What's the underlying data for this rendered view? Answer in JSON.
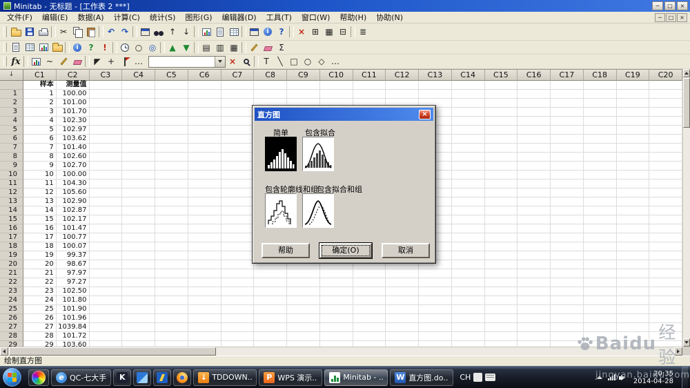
{
  "titlebar": {
    "title": "Minitab - 无标题 - [工作表 2 ***]",
    "buttons": [
      "─",
      "□",
      "×"
    ]
  },
  "menubar": {
    "items": [
      "文件(F)",
      "编辑(E)",
      "数据(A)",
      "计算(C)",
      "统计(S)",
      "图形(G)",
      "编辑器(D)",
      "工具(T)",
      "窗口(W)",
      "帮助(H)",
      "协助(N)"
    ],
    "mdi_buttons": [
      "─",
      "□",
      "×"
    ]
  },
  "toolbars": {
    "row1": [
      {
        "name": "open-project-icon",
        "t": "folder"
      },
      {
        "name": "save-project-icon",
        "t": "floppy"
      },
      {
        "name": "print-icon",
        "t": "printer"
      },
      {
        "sep": true
      },
      {
        "name": "cut-icon",
        "g": "✂"
      },
      {
        "name": "copy-icon",
        "t": "copy"
      },
      {
        "name": "paste-icon",
        "t": "paste"
      },
      {
        "sep": true
      },
      {
        "name": "undo-icon",
        "g": "↶",
        "c": "blue"
      },
      {
        "name": "redo-icon",
        "g": "↷",
        "c": "blue"
      },
      {
        "sep": true
      },
      {
        "name": "last-dialog-icon",
        "t": "window"
      },
      {
        "name": "find-icon",
        "t": "binoc"
      },
      {
        "name": "previous-command-icon",
        "g": "↑"
      },
      {
        "name": "next-command-icon",
        "g": "↓"
      },
      {
        "sep": true
      },
      {
        "name": "edit-last-graph-icon",
        "t": "chart"
      },
      {
        "name": "session-window-icon",
        "t": "doc"
      },
      {
        "name": "data-window-icon",
        "t": "grid"
      },
      {
        "sep": true
      },
      {
        "name": "project-manager-icon",
        "t": "window"
      },
      {
        "name": "statguide-icon",
        "t": "info"
      },
      {
        "name": "help-icon",
        "g": "?",
        "c": "blue"
      },
      {
        "sep": true
      },
      {
        "name": "close-all-graphs-icon",
        "g": "×",
        "c": "red"
      },
      {
        "name": "tile-windows-icon",
        "g": "⊞"
      },
      {
        "name": "cascade-windows-icon",
        "g": "▦"
      },
      {
        "name": "minimize-all-icon",
        "g": "⊟"
      },
      {
        "sep": true
      },
      {
        "name": "customize-toolbar-icon",
        "g": "≣"
      }
    ],
    "row2": [
      {
        "name": "show-session-folder-icon",
        "t": "doc"
      },
      {
        "name": "show-worksheets-folder-icon",
        "t": "grid"
      },
      {
        "name": "show-graphs-folder-icon",
        "t": "chart"
      },
      {
        "name": "show-reportpad-icon",
        "t": "folder"
      },
      {
        "sep": true
      },
      {
        "name": "project-info-icon",
        "t": "info"
      },
      {
        "name": "statguide-green-icon",
        "g": "?",
        "c": "green"
      },
      {
        "name": "alerts-icon",
        "g": "!",
        "c": "red"
      },
      {
        "sep": true
      },
      {
        "name": "history-icon",
        "t": "clock"
      },
      {
        "name": "related-items-icon",
        "g": "○"
      },
      {
        "name": "design-icon",
        "g": "◎",
        "c": "blue"
      },
      {
        "sep": true
      },
      {
        "name": "move-up-icon",
        "g": "▲",
        "c": "green"
      },
      {
        "name": "move-down-icon",
        "g": "▼",
        "c": "green"
      },
      {
        "sep": true
      },
      {
        "name": "view-list-icon",
        "g": "▤"
      },
      {
        "name": "view-columns-icon",
        "g": "▥"
      },
      {
        "name": "view-grid-icon",
        "g": "▦"
      },
      {
        "sep": true
      },
      {
        "name": "edit-cell-icon",
        "t": "pen"
      },
      {
        "name": "clear-cell-icon",
        "t": "eraser"
      },
      {
        "name": "formula-icon",
        "g": "Σ"
      }
    ],
    "row3a": [
      {
        "name": "assign-formula-icon",
        "g": "fx",
        "c": "fx"
      },
      {
        "sep": true
      },
      {
        "name": "add-graph-item-icon",
        "t": "chart"
      },
      {
        "name": "add-fit-icon",
        "g": "~"
      },
      {
        "name": "brush-icon",
        "t": "pen"
      },
      {
        "name": "erase-annotation-icon",
        "t": "eraser"
      },
      {
        "sep": true
      },
      {
        "name": "select-tool-icon",
        "g": "◤"
      },
      {
        "name": "crosshair-icon",
        "g": "+"
      },
      {
        "name": "flag-icon",
        "t": "flag"
      },
      {
        "name": "more-tools-icon",
        "g": "…"
      }
    ],
    "combo_value": "",
    "row3b": [
      {
        "name": "delete-item-icon",
        "g": "×",
        "c": "red"
      },
      {
        "name": "zoom-icon",
        "t": "zoom"
      }
    ],
    "row3c": [
      {
        "name": "text-tool-icon",
        "g": "T"
      },
      {
        "name": "line-tool-icon",
        "g": "╲"
      },
      {
        "name": "rectangle-tool-icon",
        "g": "□"
      },
      {
        "name": "ellipse-tool-icon",
        "g": "○"
      },
      {
        "name": "polygon-tool-icon",
        "g": "◇"
      },
      {
        "name": "marker-tool-icon",
        "g": "…"
      }
    ]
  },
  "worksheet": {
    "corner": "↓",
    "columns": [
      "C1",
      "C2",
      "C3",
      "C4",
      "C5",
      "C6",
      "C7",
      "C8",
      "C9",
      "C10",
      "C11",
      "C12",
      "C13",
      "C14",
      "C15",
      "C16",
      "C17",
      "C18",
      "C19",
      "C20"
    ],
    "var_names": [
      "样本",
      "测量值"
    ],
    "rows": [
      [
        "1",
        "100.00"
      ],
      [
        "2",
        "101.00"
      ],
      [
        "3",
        "101.70"
      ],
      [
        "4",
        "102.30"
      ],
      [
        "5",
        "102.97"
      ],
      [
        "6",
        "103.62"
      ],
      [
        "7",
        "101.40"
      ],
      [
        "8",
        "102.60"
      ],
      [
        "9",
        "102.70"
      ],
      [
        "10",
        "100.00"
      ],
      [
        "11",
        "104.30"
      ],
      [
        "12",
        "105.60"
      ],
      [
        "13",
        "102.90"
      ],
      [
        "14",
        "102.87"
      ],
      [
        "15",
        "102.17"
      ],
      [
        "16",
        "101.47"
      ],
      [
        "17",
        "100.77"
      ],
      [
        "18",
        "100.07"
      ],
      [
        "19",
        "99.37"
      ],
      [
        "20",
        "98.67"
      ],
      [
        "21",
        "97.97"
      ],
      [
        "22",
        "97.27"
      ],
      [
        "23",
        "102.50"
      ],
      [
        "24",
        "101.80"
      ],
      [
        "25",
        "101.90"
      ],
      [
        "26",
        "101.96"
      ],
      [
        "27",
        "1039.84"
      ],
      [
        "28",
        "101.72"
      ],
      [
        "29",
        "103.60"
      ]
    ]
  },
  "dialog": {
    "title": "直方图",
    "close": "×",
    "options": [
      {
        "label": "简单",
        "selected": true
      },
      {
        "label": "包含拟合",
        "selected": false
      },
      {
        "label": "包含轮廓线和组",
        "selected": false
      },
      {
        "label": "包含拟合和组",
        "selected": false
      }
    ],
    "buttons": {
      "help": "帮助",
      "ok": "确定(O)",
      "cancel": "取消"
    }
  },
  "statusbar": {
    "text": "绘制直方图"
  },
  "taskbar": {
    "buttons": [
      {
        "name": "taskbar-pinned-browser",
        "icon": "swirl",
        "label": ""
      },
      {
        "name": "taskbar-btn-qc-document",
        "icon": "ie",
        "label": "QC-七大手"
      },
      {
        "name": "taskbar-btn-music-player",
        "icon": "k",
        "label": ""
      },
      {
        "name": "taskbar-btn-notes",
        "icon": "pen",
        "label": ""
      },
      {
        "name": "taskbar-btn-messenger",
        "icon": "bolt",
        "label": ""
      },
      {
        "name": "taskbar-btn-firefox",
        "icon": "ff",
        "label": ""
      },
      {
        "name": "taskbar-btn-download",
        "icon": "td",
        "label": "TDDOWN..."
      },
      {
        "name": "taskbar-btn-wps",
        "icon": "wps",
        "label": "WPS 演示..."
      },
      {
        "name": "taskbar-btn-minitab",
        "icon": "minitab",
        "label": "Minitab - ...",
        "active": true
      },
      {
        "name": "taskbar-btn-word",
        "icon": "word",
        "label": "直方图.do..."
      }
    ],
    "lang": "CH",
    "time": "20:35",
    "date": "2014-04-28"
  },
  "watermark": {
    "brand": "Baidu",
    "suffix": "经验",
    "url": "jingyan.baidu.com"
  }
}
